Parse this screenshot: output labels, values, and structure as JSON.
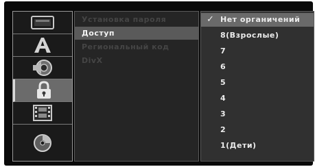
{
  "icons": [
    "tv-icon",
    "font-icon",
    "speaker-icon",
    "lock-icon",
    "film-icon",
    "disc-icon"
  ],
  "menu": {
    "items": [
      {
        "label": "Установка пароля"
      },
      {
        "label": "Доступ"
      },
      {
        "label": "Региональный код"
      },
      {
        "label": "DivX"
      }
    ],
    "selected_index": 1
  },
  "options": {
    "items": [
      {
        "label": "Нет органичений",
        "checked": true
      },
      {
        "label": "8(Взрослые)"
      },
      {
        "label": "7"
      },
      {
        "label": "6"
      },
      {
        "label": "5"
      },
      {
        "label": "4"
      },
      {
        "label": "3"
      },
      {
        "label": "2"
      },
      {
        "label": "1(Дети)"
      }
    ],
    "check_symbol": "✓"
  },
  "colors": {
    "background": "#0a0a0a",
    "selected_bg": "#5a5a5a",
    "text": "#f2f2f2",
    "dim_text": "#454545"
  }
}
